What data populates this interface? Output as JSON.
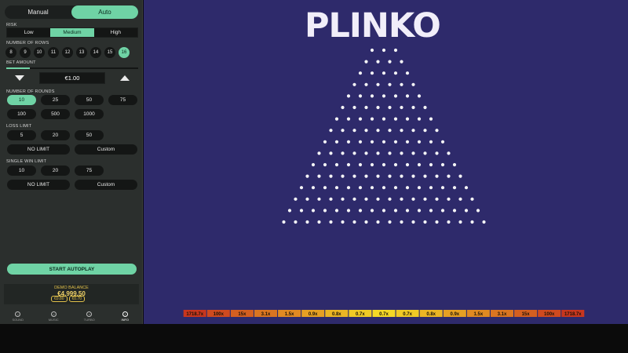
{
  "sidebar": {
    "mode_tabs": [
      {
        "label": "Manual",
        "active": false
      },
      {
        "label": "Auto",
        "active": true
      }
    ],
    "risk": {
      "label": "RISK",
      "options": [
        {
          "label": "Low",
          "active": false
        },
        {
          "label": "Medium",
          "active": true
        },
        {
          "label": "High",
          "active": false
        }
      ]
    },
    "rows": {
      "label": "NUMBER OF ROWS",
      "options": [
        "8",
        "9",
        "10",
        "11",
        "12",
        "13",
        "14",
        "15",
        "16"
      ],
      "selected": "16"
    },
    "bet": {
      "label": "BET AMOUNT",
      "value": "€1.00",
      "slider_fraction": 0.18
    },
    "rounds": {
      "label": "NUMBER OF ROUNDS",
      "options": [
        "10",
        "25",
        "50",
        "75",
        "100",
        "500",
        "1000"
      ],
      "selected": "10"
    },
    "loss_limit": {
      "label": "LOSS LIMIT",
      "options": [
        "5",
        "20",
        "50"
      ],
      "no_limit": "NO LIMIT",
      "custom": "Custom"
    },
    "win_limit": {
      "label": "SINGLE WIN LIMIT",
      "options": [
        "10",
        "20",
        "75"
      ],
      "no_limit": "NO LIMIT",
      "custom": "Custom"
    },
    "start_button": "START AUTOPLAY",
    "balance": {
      "label": "DEMO BALANCE",
      "value": "€4,999.50",
      "chips": [
        "€0.80",
        "€0.70"
      ]
    },
    "footer": [
      {
        "label": "SOUND",
        "icon": "sound-icon",
        "glyph": "♪"
      },
      {
        "label": "MUSIC",
        "icon": "music-icon",
        "glyph": "♫"
      },
      {
        "label": "TURBO",
        "icon": "turbo-icon",
        "glyph": "»"
      },
      {
        "label": "INFO",
        "icon": "info-icon",
        "glyph": "i"
      }
    ]
  },
  "game": {
    "title": "PLINKO",
    "peg_rows": 16,
    "multipliers": [
      "1718.7x",
      "100x",
      "15x",
      "3.1x",
      "1.5x",
      "0.9x",
      "0.8x",
      "0.7x",
      "0.7x",
      "0.7x",
      "0.8x",
      "0.9x",
      "1.5x",
      "3.1x",
      "15x",
      "100x",
      "1718.7x"
    ],
    "multiplier_colors": [
      "#c8361e",
      "#cf4a1f",
      "#d45f20",
      "#da7521",
      "#e08a22",
      "#e6a023",
      "#ebb524",
      "#f0ca25",
      "#f4d826",
      "#f0ca25",
      "#ebb524",
      "#e6a023",
      "#e08a22",
      "#da7521",
      "#d45f20",
      "#cf4a1f",
      "#c8361e"
    ]
  }
}
